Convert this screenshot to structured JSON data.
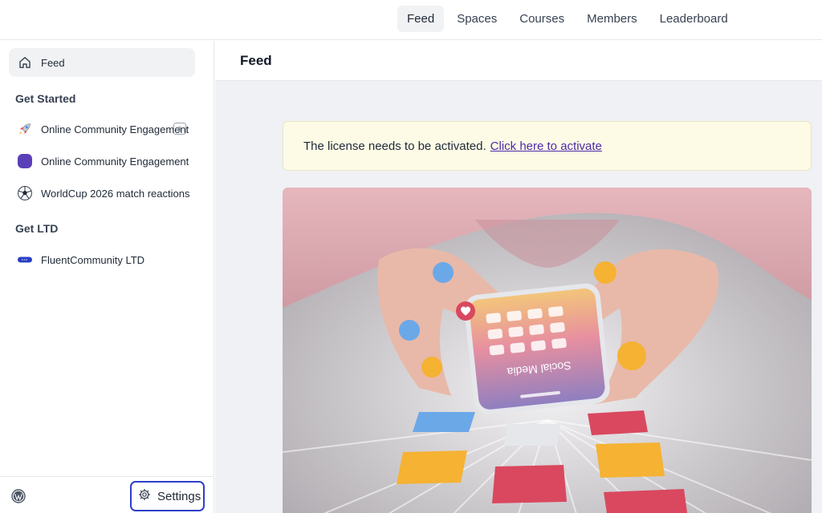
{
  "topnav": {
    "tabs": [
      {
        "label": "Feed",
        "active": true
      },
      {
        "label": "Spaces"
      },
      {
        "label": "Courses"
      },
      {
        "label": "Members"
      },
      {
        "label": "Leaderboard"
      }
    ]
  },
  "sidebar": {
    "feed_label": "Feed",
    "sections": [
      {
        "title": "Get Started",
        "items": [
          {
            "label": "Online Community Engagement",
            "icon": "rocket-icon",
            "badge": "1"
          },
          {
            "label": "Online Community Engagement",
            "icon": "purple-square-icon"
          },
          {
            "label": "WorldCup 2026 match reactions",
            "icon": "soccer-ball-icon"
          }
        ]
      },
      {
        "title": "Get LTD",
        "items": [
          {
            "label": "FluentCommunity LTD",
            "icon": "ticket-icon"
          }
        ]
      }
    ],
    "settings_label": "Settings"
  },
  "main": {
    "title": "Feed",
    "notice": {
      "text": "The license needs to be activated.",
      "link": "Click here to activate"
    },
    "hero_overlay_text": "Social Media"
  },
  "colors": {
    "accent_border": "#2c3fc9",
    "notice_bg": "#fdfbe6",
    "link": "#4b2aa8",
    "purple_icon": "#5b3fb8",
    "ticket_icon": "#2a3ec4"
  }
}
